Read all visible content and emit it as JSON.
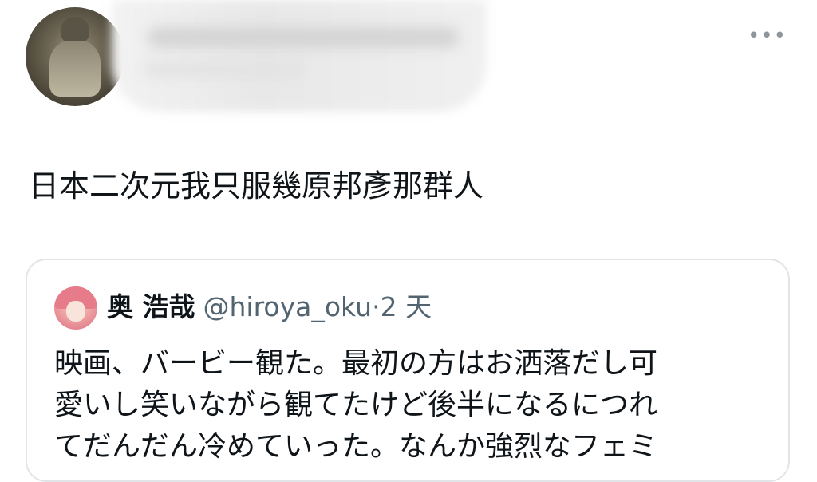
{
  "tweet": {
    "text": "日本二次元我只服幾原邦彥那群人",
    "more_label": "•••"
  },
  "quote": {
    "name": "奥 浩哉",
    "handle": "@hiroya_oku",
    "separator": "·",
    "time": "2 天",
    "lines": [
      "映画、バービー観た。最初の方はお洒落だし可",
      "愛いし笑いながら観てたけど後半になるにつれ",
      "てだんだん冷めていった。なんか強烈なフェミ"
    ]
  }
}
